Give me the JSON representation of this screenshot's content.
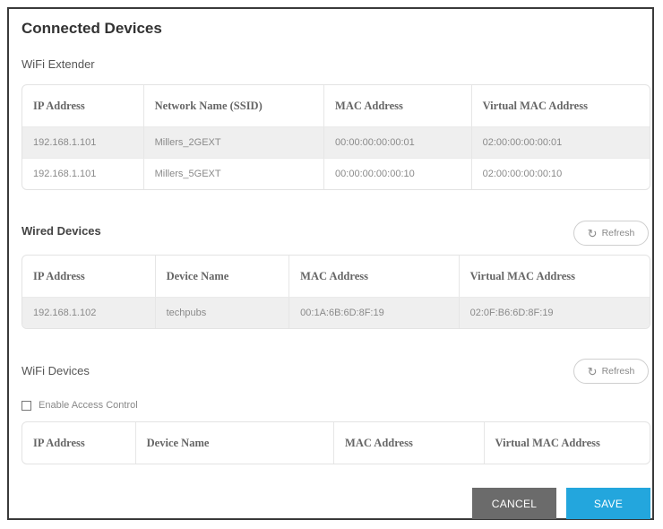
{
  "page": {
    "title": "Connected Devices"
  },
  "wifi_extender": {
    "title": "WiFi Extender",
    "columns": [
      "IP Address",
      "Network Name (SSID)",
      "MAC Address",
      "Virtual MAC Address"
    ],
    "rows": [
      [
        "192.168.1.101",
        "Millers_2GEXT",
        "00:00:00:00:00:01",
        "02:00:00:00:00:01"
      ],
      [
        "192.168.1.101",
        "Millers_5GEXT",
        "00:00:00:00:00:10",
        "02:00:00:00:00:10"
      ]
    ]
  },
  "wired_devices": {
    "title": "Wired Devices",
    "refresh_label": "Refresh",
    "columns": [
      "IP Address",
      "Device Name",
      "MAC Address",
      "Virtual MAC Address"
    ],
    "rows": [
      [
        "192.168.1.102",
        "techpubs",
        "00:1A:6B:6D:8F:19",
        "02:0F:B6:6D:8F:19"
      ]
    ]
  },
  "wifi_devices": {
    "title": "WiFi Devices",
    "refresh_label": "Refresh",
    "access_control_label": "Enable Access Control",
    "access_control_checked": false,
    "columns": [
      "IP Address",
      "Device Name",
      "MAC Address",
      "Virtual MAC Address"
    ],
    "rows": []
  },
  "actions": {
    "cancel_label": "CANCEL",
    "save_label": "SAVE"
  },
  "colors": {
    "save": "#23a6dd",
    "cancel": "#6b6b6b",
    "shaded_row": "#efefef"
  },
  "icons": {
    "refresh": "refresh-icon"
  }
}
